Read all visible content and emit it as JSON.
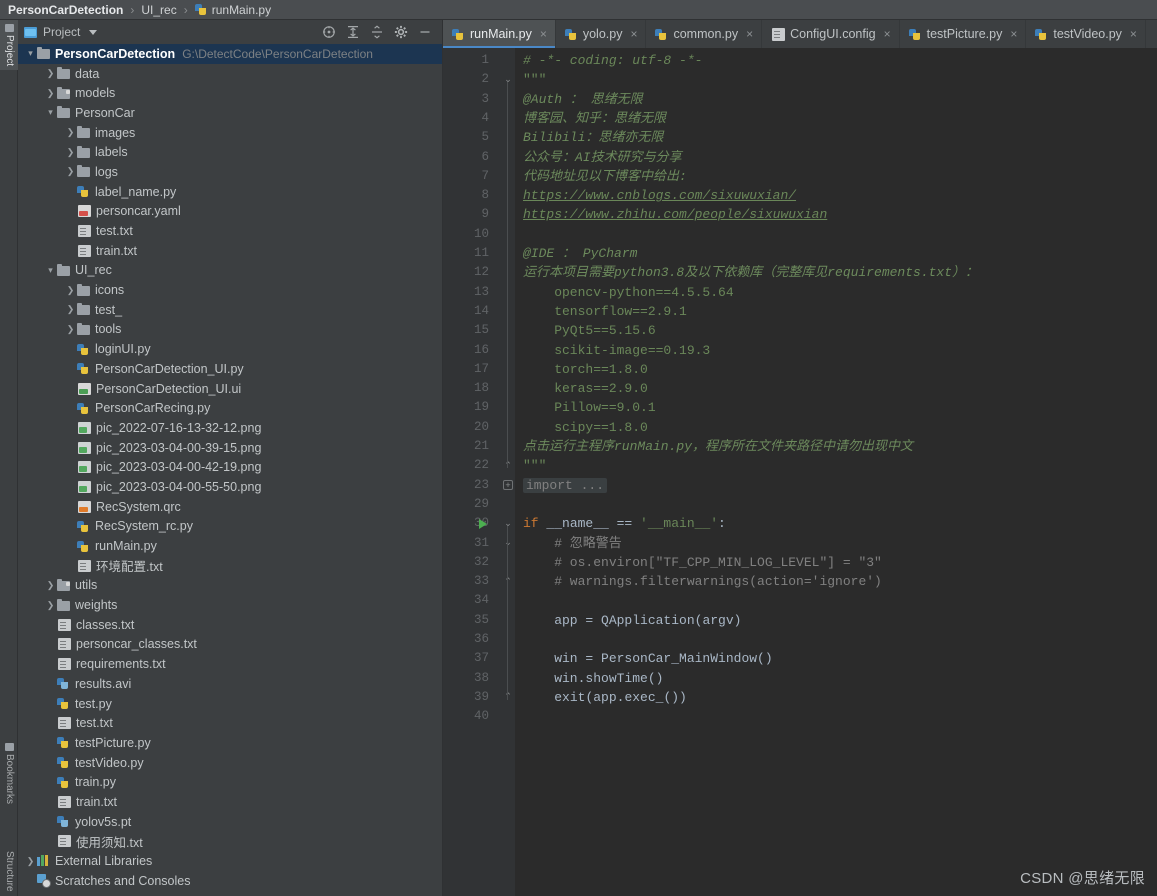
{
  "breadcrumb": {
    "project": "PersonCarDetection",
    "folder": "UI_rec",
    "file": "runMain.py",
    "sep": "›"
  },
  "left_tool_tabs": [
    {
      "label": "Project",
      "active": true
    },
    {
      "label": "Bookmarks",
      "active": false
    },
    {
      "label": "Structure",
      "active": false
    }
  ],
  "project_panel": {
    "title": "Project",
    "tools": [
      "locate-icon",
      "expand-all-icon",
      "collapse-all-icon",
      "settings-icon",
      "hide-icon"
    ],
    "root": {
      "label": "PersonCarDetection",
      "path": "G:\\DetectCode\\PersonCarDetection"
    },
    "tree": [
      {
        "label": "data",
        "indent": 1,
        "arrow": "collapsed",
        "icon": "folder"
      },
      {
        "label": "models",
        "indent": 1,
        "arrow": "collapsed",
        "icon": "folder-module"
      },
      {
        "label": "PersonCar",
        "indent": 1,
        "arrow": "expanded",
        "icon": "folder"
      },
      {
        "label": "images",
        "indent": 2,
        "arrow": "collapsed",
        "icon": "folder"
      },
      {
        "label": "labels",
        "indent": 2,
        "arrow": "collapsed",
        "icon": "folder"
      },
      {
        "label": "logs",
        "indent": 2,
        "arrow": "collapsed",
        "icon": "folder"
      },
      {
        "label": "label_name.py",
        "indent": 2,
        "arrow": "none",
        "icon": "python"
      },
      {
        "label": "personcar.yaml",
        "indent": 2,
        "arrow": "none",
        "icon": "yaml"
      },
      {
        "label": "test.txt",
        "indent": 2,
        "arrow": "none",
        "icon": "text"
      },
      {
        "label": "train.txt",
        "indent": 2,
        "arrow": "none",
        "icon": "text"
      },
      {
        "label": "UI_rec",
        "indent": 1,
        "arrow": "expanded",
        "icon": "folder"
      },
      {
        "label": "icons",
        "indent": 2,
        "arrow": "collapsed",
        "icon": "folder"
      },
      {
        "label": "test_",
        "indent": 2,
        "arrow": "collapsed",
        "icon": "folder"
      },
      {
        "label": "tools",
        "indent": 2,
        "arrow": "collapsed",
        "icon": "folder"
      },
      {
        "label": "loginUI.py",
        "indent": 2,
        "arrow": "none",
        "icon": "python"
      },
      {
        "label": "PersonCarDetection_UI.py",
        "indent": 2,
        "arrow": "none",
        "icon": "python"
      },
      {
        "label": "PersonCarDetection_UI.ui",
        "indent": 2,
        "arrow": "none",
        "icon": "ui"
      },
      {
        "label": "PersonCarRecing.py",
        "indent": 2,
        "arrow": "none",
        "icon": "python"
      },
      {
        "label": "pic_2022-07-16-13-32-12.png",
        "indent": 2,
        "arrow": "none",
        "icon": "png"
      },
      {
        "label": "pic_2023-03-04-00-39-15.png",
        "indent": 2,
        "arrow": "none",
        "icon": "png"
      },
      {
        "label": "pic_2023-03-04-00-42-19.png",
        "indent": 2,
        "arrow": "none",
        "icon": "png"
      },
      {
        "label": "pic_2023-03-04-00-55-50.png",
        "indent": 2,
        "arrow": "none",
        "icon": "png"
      },
      {
        "label": "RecSystem.qrc",
        "indent": 2,
        "arrow": "none",
        "icon": "qrc"
      },
      {
        "label": "RecSystem_rc.py",
        "indent": 2,
        "arrow": "none",
        "icon": "python"
      },
      {
        "label": "runMain.py",
        "indent": 2,
        "arrow": "none",
        "icon": "python"
      },
      {
        "label": "环境配置.txt",
        "indent": 2,
        "arrow": "none",
        "icon": "text"
      },
      {
        "label": "utils",
        "indent": 1,
        "arrow": "collapsed",
        "icon": "folder-module"
      },
      {
        "label": "weights",
        "indent": 1,
        "arrow": "collapsed",
        "icon": "folder"
      },
      {
        "label": "classes.txt",
        "indent": 1,
        "arrow": "none",
        "icon": "text"
      },
      {
        "label": "personcar_classes.txt",
        "indent": 1,
        "arrow": "none",
        "icon": "text"
      },
      {
        "label": "requirements.txt",
        "indent": 1,
        "arrow": "none",
        "icon": "text"
      },
      {
        "label": "results.avi",
        "indent": 1,
        "arrow": "none",
        "icon": "binary"
      },
      {
        "label": "test.py",
        "indent": 1,
        "arrow": "none",
        "icon": "python"
      },
      {
        "label": "test.txt",
        "indent": 1,
        "arrow": "none",
        "icon": "text"
      },
      {
        "label": "testPicture.py",
        "indent": 1,
        "arrow": "none",
        "icon": "python"
      },
      {
        "label": "testVideo.py",
        "indent": 1,
        "arrow": "none",
        "icon": "python"
      },
      {
        "label": "train.py",
        "indent": 1,
        "arrow": "none",
        "icon": "python"
      },
      {
        "label": "train.txt",
        "indent": 1,
        "arrow": "none",
        "icon": "text"
      },
      {
        "label": "yolov5s.pt",
        "indent": 1,
        "arrow": "none",
        "icon": "binary"
      },
      {
        "label": "使用须知.txt",
        "indent": 1,
        "arrow": "none",
        "icon": "text"
      },
      {
        "label": "External Libraries",
        "indent": 0,
        "arrow": "collapsed",
        "icon": "library"
      },
      {
        "label": "Scratches and Consoles",
        "indent": 0,
        "arrow": "none",
        "icon": "scratch"
      }
    ]
  },
  "editor_tabs": [
    {
      "label": "runMain.py",
      "icon": "python",
      "active": true
    },
    {
      "label": "yolo.py",
      "icon": "python",
      "active": false
    },
    {
      "label": "common.py",
      "icon": "python",
      "active": false
    },
    {
      "label": "ConfigUI.config",
      "icon": "config",
      "active": false
    },
    {
      "label": "testPicture.py",
      "icon": "python",
      "active": false
    },
    {
      "label": "testVideo.py",
      "icon": "python",
      "active": false
    }
  ],
  "editor": {
    "filename": "runMain.py",
    "gutter_run_marker_line": 30,
    "lines": [
      {
        "no": 1,
        "text": "# -*- coding: utf-8 -*-",
        "style": "comment"
      },
      {
        "no": 2,
        "text": "\"\"\"",
        "style": "docstr"
      },
      {
        "no": 3,
        "text": "@Auth ： 思绪无限",
        "style": "cn"
      },
      {
        "no": 4,
        "text": "博客园、知乎：思绪无限",
        "style": "cn"
      },
      {
        "no": 5,
        "text": "Bilibili：思绪亦无限",
        "style": "cn"
      },
      {
        "no": 6,
        "text": "公众号：AI技术研究与分享",
        "style": "cn"
      },
      {
        "no": 7,
        "text": "代码地址见以下博客中给出:",
        "style": "cn"
      },
      {
        "no": 8,
        "text": "https://www.cnblogs.com/sixuwuxian/",
        "style": "link"
      },
      {
        "no": 9,
        "text": "https://www.zhihu.com/people/sixuwuxian",
        "style": "link"
      },
      {
        "no": 10,
        "text": "",
        "style": "docstr"
      },
      {
        "no": 11,
        "text": "@IDE ： PyCharm",
        "style": "cn"
      },
      {
        "no": 12,
        "text": "运行本项目需要python3.8及以下依赖库（完整库见requirements.txt）：",
        "style": "cn"
      },
      {
        "no": 13,
        "text": "    opencv-python==4.5.5.64",
        "style": "docstr"
      },
      {
        "no": 14,
        "text": "    tensorflow==2.9.1",
        "style": "docstr"
      },
      {
        "no": 15,
        "text": "    PyQt5==5.15.6",
        "style": "docstr"
      },
      {
        "no": 16,
        "text": "    scikit-image==0.19.3",
        "style": "docstr"
      },
      {
        "no": 17,
        "text": "    torch==1.8.0",
        "style": "docstr"
      },
      {
        "no": 18,
        "text": "    keras==2.9.0",
        "style": "docstr"
      },
      {
        "no": 19,
        "text": "    Pillow==9.0.1",
        "style": "docstr"
      },
      {
        "no": 20,
        "text": "    scipy==1.8.0",
        "style": "docstr"
      },
      {
        "no": 21,
        "text": "点击运行主程序runMain.py，程序所在文件夹路径中请勿出现中文",
        "style": "cn"
      },
      {
        "no": 22,
        "text": "\"\"\"",
        "style": "docstr"
      },
      {
        "no": 23,
        "text": "import ...",
        "style": "fold"
      },
      {
        "no": 29,
        "text": "",
        "style": "plain"
      },
      {
        "no": 30,
        "text": "if __name__ == '__main__':",
        "style": "main"
      },
      {
        "no": 31,
        "text": "    # 忽略警告",
        "style": "greycom"
      },
      {
        "no": 32,
        "text": "    # os.environ[\"TF_CPP_MIN_LOG_LEVEL\"] = \"3\"",
        "style": "greycom"
      },
      {
        "no": 33,
        "text": "    # warnings.filterwarnings(action='ignore')",
        "style": "greycom"
      },
      {
        "no": 34,
        "text": "",
        "style": "plain"
      },
      {
        "no": 35,
        "text": "    app = QApplication(argv)",
        "style": "plain"
      },
      {
        "no": 36,
        "text": "",
        "style": "plain"
      },
      {
        "no": 37,
        "text": "    win = PersonCar_MainWindow()",
        "style": "plain"
      },
      {
        "no": 38,
        "text": "    win.showTime()",
        "style": "plain"
      },
      {
        "no": 39,
        "text": "    exit(app.exec_())",
        "style": "plain"
      },
      {
        "no": 40,
        "text": "",
        "style": "plain"
      }
    ]
  },
  "watermark": "CSDN @思绪无限",
  "colors": {
    "accent": "#4a88c7",
    "selection": "#1c3551",
    "editor_bg": "#2b2b2b",
    "panel_bg": "#3c3f41",
    "gutter_bg": "#313335",
    "comment": "#6a8759",
    "keyword": "#cc7832",
    "text": "#a9b7c6"
  }
}
